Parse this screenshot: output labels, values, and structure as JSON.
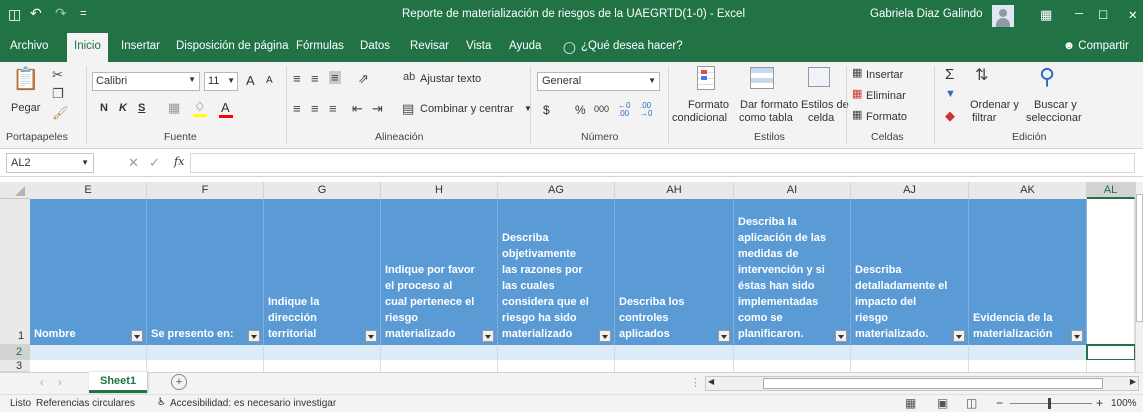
{
  "window": {
    "title": "Reporte de materialización de riesgos de la UAEGRTD(1-0)  -  Excel",
    "user": "Gabriela Diaz Galindo",
    "controls": [
      "─",
      "☐",
      "✕"
    ]
  },
  "quick_access": {
    "save": "H",
    "undo": "↶",
    "redo": "↷",
    "customize": "="
  },
  "menu_tabs": [
    "Archivo",
    "Inicio",
    "Insertar",
    "Disposición de página",
    "Fórmulas",
    "Datos",
    "Revisar",
    "Vista",
    "Ayuda"
  ],
  "active_tab": "Inicio",
  "tell_me": "¿Qué desea hacer?",
  "share": "Compartir",
  "ribbon": {
    "clipboard": {
      "paste": "Pegar",
      "label": "Portapapeles"
    },
    "font": {
      "name": "Calibri",
      "size": "11",
      "bold": "N",
      "italic": "K",
      "underline": "S",
      "grow": "A",
      "shrink": "A",
      "label": "Fuente",
      "font_color": "A"
    },
    "alignment": {
      "wrap": "Ajustar texto",
      "merge": "Combinar y centrar",
      "label": "Alineación"
    },
    "number": {
      "format": "General",
      "currency": "$",
      "percent": "%",
      "thousands": "000",
      "inc_dec": "←,0 .00",
      "dec_dec": ",00 →,0",
      "label": "Número"
    },
    "styles": {
      "conditional_1": "Formato",
      "conditional_2": "condicional",
      "as_table_1": "Dar formato",
      "as_table_2": "como tabla",
      "cell_styles_1": "Estilos de",
      "cell_styles_2": "celda",
      "label": "Estilos"
    },
    "cells": {
      "insert": "Insertar",
      "delete": "Eliminar",
      "format": "Formato",
      "label": "Celdas"
    },
    "editing": {
      "sort_1": "Ordenar y",
      "sort_2": "filtrar",
      "find_1": "Buscar y",
      "find_2": "seleccionar",
      "label": "Edición",
      "sum": "Σ"
    }
  },
  "formula_bar": {
    "name_box": "AL2",
    "fx": "fx",
    "value": ""
  },
  "columns": [
    {
      "letter": "E",
      "header": "Nombre"
    },
    {
      "letter": "F",
      "header": "Se presento en:"
    },
    {
      "letter": "G",
      "header": "Indique la dirección territorial"
    },
    {
      "letter": "H",
      "header": "Indique por favor el proceso al cual pertenece el riesgo materializado"
    },
    {
      "letter": "AG",
      "header": "Describa objetivamente las razones por las cuales considera que el riesgo ha sido materializado"
    },
    {
      "letter": "AH",
      "header": "Describa los controles aplicados"
    },
    {
      "letter": "AI",
      "header": "Describa la aplicación de las medidas de intervención y si éstas han sido implementadas como se planificaron."
    },
    {
      "letter": "AJ",
      "header": "Describa detalladamente el impacto del riesgo materializado."
    },
    {
      "letter": "AK",
      "header": "Evidencia de la materialización"
    },
    {
      "letter": "AL",
      "header": ""
    }
  ],
  "rows": [
    "1",
    "2",
    "3"
  ],
  "sheets": [
    "Sheet1"
  ],
  "add_sheet": "+",
  "status": {
    "ready": "Listo",
    "circular": "Referencias circulares",
    "accessibility": "Accesibilidad: es necesario investigar",
    "zoom": "100%"
  },
  "colors": {
    "excel_green": "#217346",
    "header_blue": "#5b9bd5",
    "row_blue": "#ddebf7"
  }
}
